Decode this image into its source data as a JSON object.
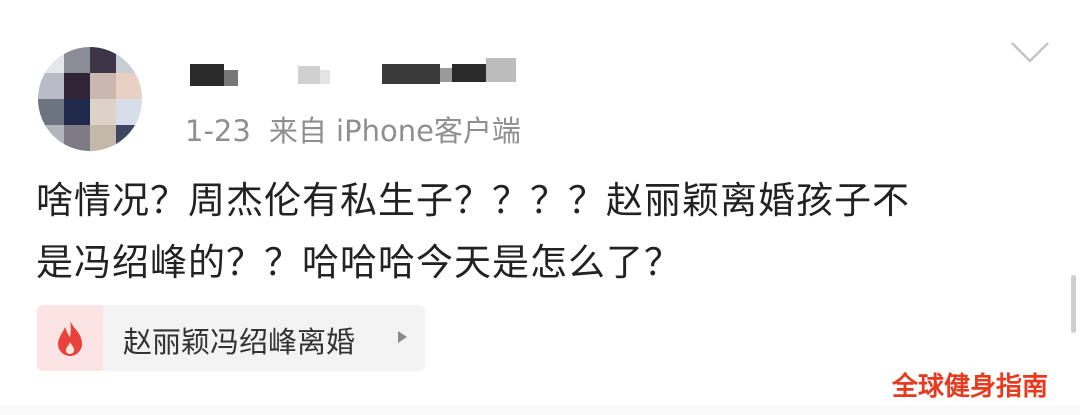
{
  "post": {
    "date": "1-23",
    "source": "来自 iPhone客户端",
    "text_line1": "啥情况？周杰伦有私生子？？？？赵丽颖离婚孩子不",
    "text_line2": "是冯绍峰的？？哈哈哈今天是怎么了？"
  },
  "topic": {
    "label": "赵丽颖冯绍峰离婚",
    "icon": "fire-icon"
  },
  "watermark": "全球健身指南",
  "icons": {
    "more": "chevron-down-icon",
    "topic_arrow": "triangle-right-icon"
  },
  "colors": {
    "meta_text": "#8f8f8f",
    "post_text": "#222222",
    "topic_bg": "#f3f3f3",
    "fire_bg": "#fde4e4",
    "fire": "#e8423b",
    "watermark": "#e83a1f"
  }
}
